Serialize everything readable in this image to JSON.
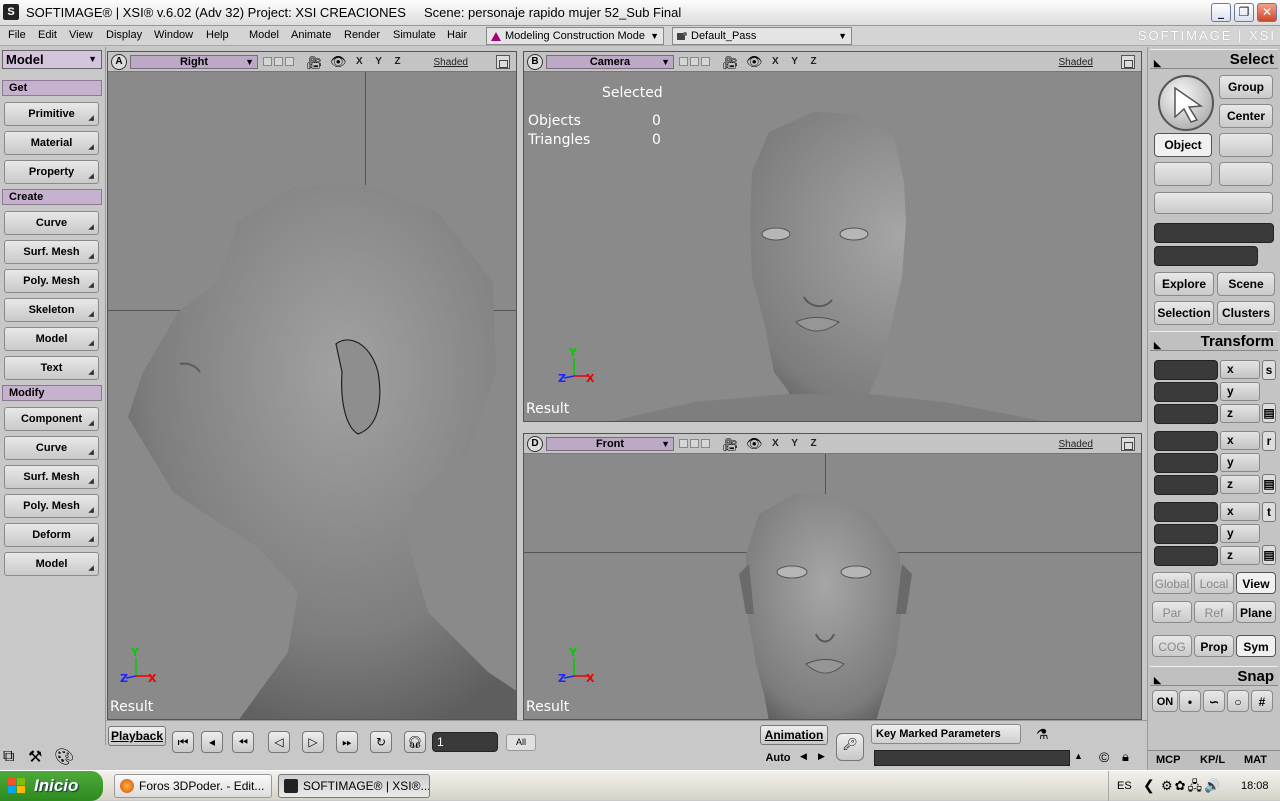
{
  "titlebar": {
    "app_icon": "S",
    "title": "SOFTIMAGE® | XSI® v.6.02 (Adv 32) Project: XSI CREACIONES     Scene: personaje rapido mujer 52_Sub Final",
    "minimize": "_",
    "maximize": "❐",
    "close": "✕"
  },
  "menubar": {
    "items": [
      "File",
      "Edit",
      "View",
      "Display",
      "Window",
      "Help",
      "Model",
      "Animate",
      "Render",
      "Simulate",
      "Hair"
    ],
    "construction_mode": "Modeling Construction Mode",
    "pass": "Default_Pass",
    "brand": "SOFTIMAGE | XSI"
  },
  "leftpanel": {
    "mode": "Model",
    "get_header": "Get",
    "get_items": [
      "Primitive",
      "Material",
      "Property"
    ],
    "create_header": "Create",
    "create_items": [
      "Curve",
      "Surf. Mesh",
      "Poly. Mesh",
      "Skeleton",
      "Model",
      "Text"
    ],
    "modify_header": "Modify",
    "modify_items": [
      "Component",
      "Curve",
      "Surf. Mesh",
      "Poly. Mesh",
      "Deform",
      "Model"
    ]
  },
  "viewports": {
    "a": {
      "letter": "A",
      "view": "Right",
      "xyz": "X Y Z",
      "shading": "Shaded",
      "result": "Result"
    },
    "b": {
      "letter": "B",
      "view": "Camera",
      "xyz": "X Y Z",
      "shading": "Shaded",
      "result": "Result",
      "stats_title": "Selected",
      "objects_label": "Objects",
      "objects_value": "0",
      "triangles_label": "Triangles",
      "triangles_value": "0"
    },
    "d": {
      "letter": "D",
      "view": "Front",
      "xyz": "X Y Z",
      "shading": "Shaded",
      "result": "Result"
    },
    "axis": {
      "x": "X",
      "y": "Y",
      "z": "Z"
    }
  },
  "rightpanel": {
    "select_header": "Select",
    "group": "Group",
    "center": "Center",
    "object": "Object",
    "explore": "Explore",
    "scene": "Scene",
    "selection": "Selection",
    "clusters": "Clusters",
    "transform_header": "Transform",
    "axes": [
      "x",
      "y",
      "z"
    ],
    "scale": "s",
    "rotate": "r",
    "translate": "t",
    "global": "Global",
    "local": "Local",
    "view": "View",
    "par": "Par",
    "ref": "Ref",
    "plane": "Plane",
    "cog": "COG",
    "prop": "Prop",
    "sym": "Sym",
    "snap_header": "Snap",
    "snap_on": "ON",
    "tabs": [
      "MCP",
      "KP/L",
      "MAT"
    ]
  },
  "timeline": {
    "playback": "Playback",
    "frame": "1",
    "all": "All",
    "animation": "Animation",
    "auto": "Auto",
    "key_marked": "Key Marked Parameters"
  },
  "taskbar": {
    "start": "Inicio",
    "tasks": [
      "Foros 3DPoder. - Edit...",
      "SOFTIMAGE® | XSI®..."
    ],
    "lang": "ES",
    "time": "18:08"
  }
}
